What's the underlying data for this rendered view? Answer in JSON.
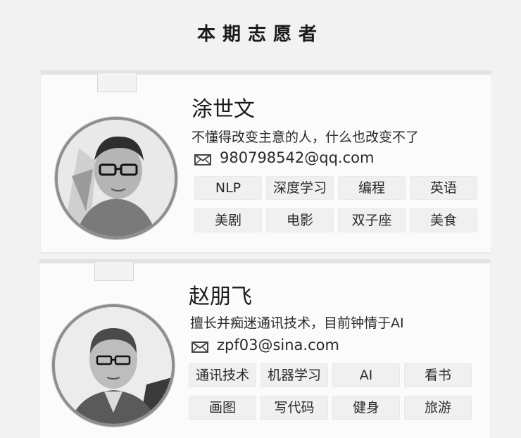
{
  "page": {
    "title": "本期志愿者"
  },
  "volunteers": [
    {
      "name": "涂世文",
      "motto": "不懂得改变主意的人，什么也改变不了",
      "email": "980798542@qq.com",
      "tags": [
        "NLP",
        "深度学习",
        "编程",
        "英语",
        "美剧",
        "电影",
        "双子座",
        "美食"
      ]
    },
    {
      "name": "赵朋飞",
      "motto": "擅长并痴迷通讯技术，目前钟情于AI",
      "email": "zpf03@sina.com",
      "tags": [
        "通讯技术",
        "机器学习",
        "AI",
        "看书",
        "画图",
        "写代码",
        "健身",
        "旅游"
      ]
    }
  ]
}
